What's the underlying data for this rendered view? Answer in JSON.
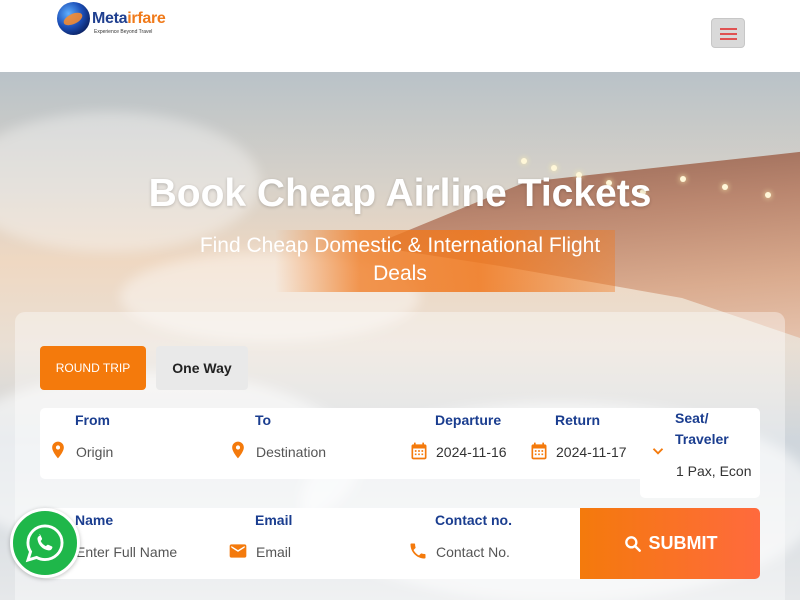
{
  "brand": {
    "name_part1": "Meta",
    "name_part2": "irfare",
    "tagline": "Experience Beyond Travel",
    "primary_color": "#1f3f8f",
    "accent_color": "#f47a0c"
  },
  "header": {
    "menu_icon": "hamburger-icon"
  },
  "hero": {
    "title": "Book Cheap Airline Tickets",
    "subtitle": "Find Cheap Domestic & International Flight Deals"
  },
  "trip_types": {
    "round_trip": "ROUND TRIP",
    "one_way": "One Way",
    "selected": "ROUND TRIP"
  },
  "search": {
    "from": {
      "label": "From",
      "placeholder": "Origin",
      "icon": "map-pin-icon"
    },
    "to": {
      "label": "To",
      "placeholder": "Destination",
      "icon": "map-pin-icon"
    },
    "departure": {
      "label": "Departure",
      "value": "2024-11-16",
      "icon": "calendar-icon"
    },
    "return": {
      "label": "Return",
      "value": "2024-11-17",
      "icon": "calendar-icon"
    },
    "seat": {
      "label_line1": "Seat/",
      "label_line2": "Traveler",
      "value": "1 Pax, Econ",
      "icon": "chevron-down-icon"
    }
  },
  "contact": {
    "name": {
      "label": "Name",
      "placeholder": "Enter Full Name"
    },
    "email": {
      "label": "Email",
      "placeholder": "Email",
      "icon": "mail-icon"
    },
    "phone": {
      "label": "Contact no.",
      "placeholder": "Contact No.",
      "icon": "phone-icon"
    }
  },
  "submit": {
    "label": "SUBMIT",
    "icon": "search-icon"
  },
  "floating": {
    "whatsapp_icon": "whatsapp-icon"
  }
}
